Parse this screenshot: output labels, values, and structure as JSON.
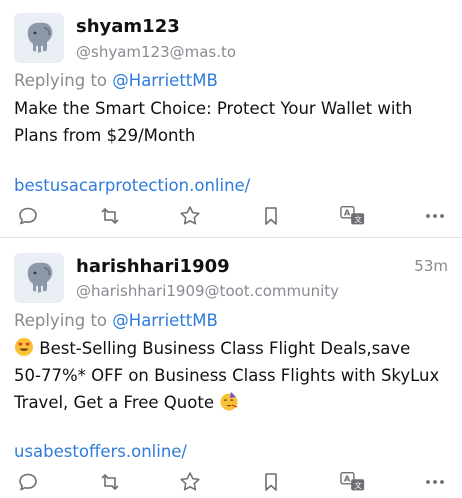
{
  "posts": [
    {
      "display_name": "shyam123",
      "handle": "@shyam123@mas.to",
      "time": "",
      "replying_prefix": "Replying to ",
      "replying_mention": "@HarriettMB",
      "body_lines": [
        "Make the Smart Choice: Protect Your Wallet with",
        "Plans from $29/Month"
      ],
      "link": "bestusacarprotection.online/"
    },
    {
      "display_name": "harishhari1909",
      "handle": "@harishhari1909@toot.community",
      "time": "53m",
      "replying_prefix": "Replying to ",
      "replying_mention": "@HarriettMB",
      "body_line1": "Best-Selling Business Class Flight Deals,save",
      "body_line2": "50-77%* OFF on Business Class Flights with SkyLux",
      "body_line3": "Travel, Get a Free Quote",
      "link": "usabestoffers.online/"
    }
  ],
  "icons": {
    "avatar": "mastodon-elephant-icon",
    "reply": "reply-bubble-icon",
    "boost": "boost-arrows-icon",
    "favourite": "star-icon",
    "bookmark": "bookmark-icon",
    "translate": "translate-icon",
    "more": "ellipsis-icon",
    "emoji_start": "heart-eyes-emoji-icon",
    "emoji_end": "party-face-emoji-icon"
  },
  "colors": {
    "link": "#2f7bdb",
    "muted": "#8a8a92",
    "icon": "#6e6e76"
  }
}
